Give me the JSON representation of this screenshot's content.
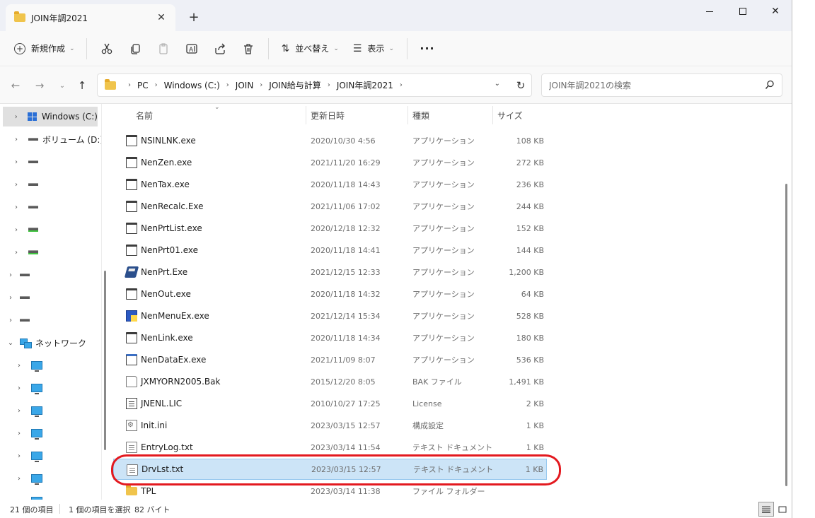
{
  "tab": {
    "title": "JOIN年調2021"
  },
  "toolbar": {
    "new_label": "新規作成",
    "sort_label": "並べ替え",
    "view_label": "表示",
    "more_label": "···"
  },
  "address": {
    "crumbs": [
      "PC",
      "Windows (C:)",
      "JOIN",
      "JOIN給与計算",
      "JOIN年調2021"
    ]
  },
  "search": {
    "placeholder": "JOIN年調2021の検索"
  },
  "nav": {
    "items": [
      {
        "label": "Windows (C:)"
      },
      {
        "label": "ボリューム (D:)"
      },
      {
        "label": "ネットワーク"
      }
    ]
  },
  "columns": {
    "name": "名前",
    "date": "更新日時",
    "type": "種類",
    "size": "サイズ"
  },
  "files": [
    {
      "name": "NSINLNK.exe",
      "date": "2020/10/30 4:56",
      "type": "アプリケーション",
      "size": "108 KB",
      "icon": "exe-icon"
    },
    {
      "name": "NenZen.exe",
      "date": "2021/11/20 16:29",
      "type": "アプリケーション",
      "size": "272 KB",
      "icon": "exe-icon"
    },
    {
      "name": "NenTax.exe",
      "date": "2020/11/18 14:43",
      "type": "アプリケーション",
      "size": "236 KB",
      "icon": "exe-icon"
    },
    {
      "name": "NenRecalc.Exe",
      "date": "2021/11/06 17:02",
      "type": "アプリケーション",
      "size": "244 KB",
      "icon": "exe-icon"
    },
    {
      "name": "NenPrtList.exe",
      "date": "2020/12/18 12:32",
      "type": "アプリケーション",
      "size": "152 KB",
      "icon": "exe-icon"
    },
    {
      "name": "NenPrt01.exe",
      "date": "2020/11/18 14:41",
      "type": "アプリケーション",
      "size": "144 KB",
      "icon": "exe-icon"
    },
    {
      "name": "NenPrt.Exe",
      "date": "2021/12/15 12:33",
      "type": "アプリケーション",
      "size": "1,200 KB",
      "icon": "printer-icon"
    },
    {
      "name": "NenOut.exe",
      "date": "2020/11/18 14:32",
      "type": "アプリケーション",
      "size": "64 KB",
      "icon": "exe-icon"
    },
    {
      "name": "NenMenuEx.exe",
      "date": "2021/12/14 15:34",
      "type": "アプリケーション",
      "size": "528 KB",
      "icon": "menu-app-icon"
    },
    {
      "name": "NenLink.exe",
      "date": "2020/11/18 14:34",
      "type": "アプリケーション",
      "size": "180 KB",
      "icon": "exe-icon"
    },
    {
      "name": "NenDataEx.exe",
      "date": "2021/11/09 8:07",
      "type": "アプリケーション",
      "size": "536 KB",
      "icon": "exe-icon"
    },
    {
      "name": "JXMYORN2005.Bak",
      "date": "2015/12/20 8:05",
      "type": "BAK ファイル",
      "size": "1,491 KB",
      "icon": "blank-file-icon"
    },
    {
      "name": "JNENL.LIC",
      "date": "2010/10/27 17:25",
      "type": "License",
      "size": "2 KB",
      "icon": "license-file-icon"
    },
    {
      "name": "Init.ini",
      "date": "2023/03/15 12:57",
      "type": "構成設定",
      "size": "1 KB",
      "icon": "config-file-icon"
    },
    {
      "name": "EntryLog.txt",
      "date": "2023/03/14 11:54",
      "type": "テキスト ドキュメント",
      "size": "1 KB",
      "icon": "text-file-icon"
    },
    {
      "name": "DrvLst.txt",
      "date": "2023/03/15 12:57",
      "type": "テキスト ドキュメント",
      "size": "1 KB",
      "icon": "text-file-icon",
      "selected": true
    },
    {
      "name": "TPL",
      "date": "2023/03/14 11:38",
      "type": "ファイル フォルダー",
      "size": "",
      "icon": "folder-icon"
    }
  ],
  "status": {
    "count": "21 個の項目",
    "selection": "1 個の項目を選択",
    "size": "82 バイト"
  },
  "colors": {
    "selection_bg": "#cce4f7",
    "annotation": "#e3191f",
    "accent": "#2a6fd6"
  }
}
